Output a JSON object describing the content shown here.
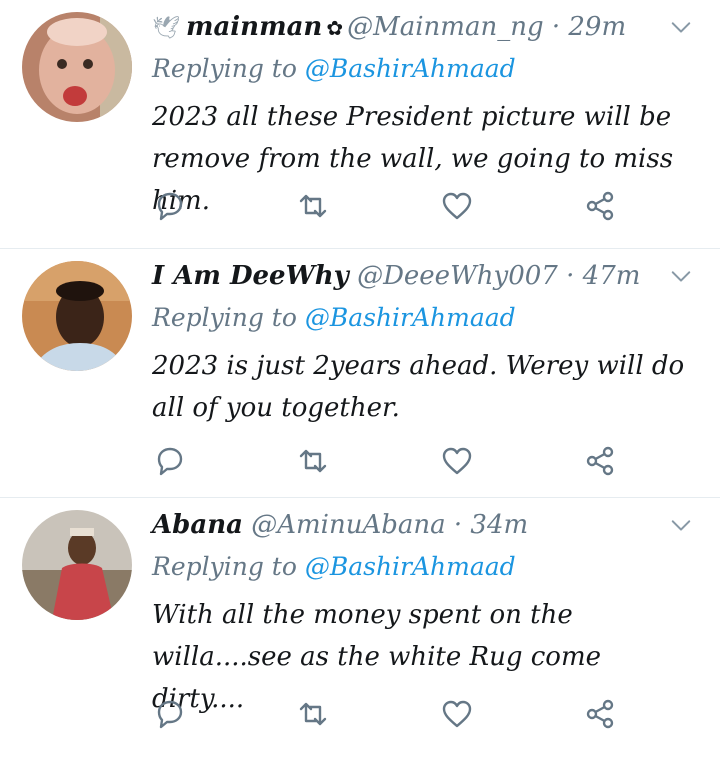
{
  "tweets": [
    {
      "prefix_icon": "dove-icon",
      "name": "mainman",
      "badge_icon": "flower-badge-icon",
      "handle": "@Mainman_ng",
      "separator": "·",
      "time": "29m",
      "replying_label": "Replying to",
      "replying_to": "@BashirAhmaad",
      "text": "2023 all these President picture will be remove from the wall, we going to miss him."
    },
    {
      "name": "I Am DeeWhy",
      "handle": "@DeeeWhy007",
      "separator": "·",
      "time": "47m",
      "replying_label": "Replying to",
      "replying_to": "@BashirAhmaad",
      "text": "2023 is just 2years ahead. Werey will do all of you together."
    },
    {
      "name": "Abana",
      "handle": "@AminuAbana",
      "separator": "·",
      "time": "34m",
      "replying_label": "Replying to",
      "replying_to": "@BashirAhmaad",
      "text": "With all the money spent on the willa....see as the white Rug come dirty...."
    }
  ],
  "icons": [
    "reply-icon",
    "retweet-icon",
    "like-icon",
    "share-icon",
    "chevron-down-icon"
  ],
  "colors": {
    "text": "#14171a",
    "muted": "#657786",
    "link": "#1b95e0",
    "divider": "#e6ecf0"
  }
}
